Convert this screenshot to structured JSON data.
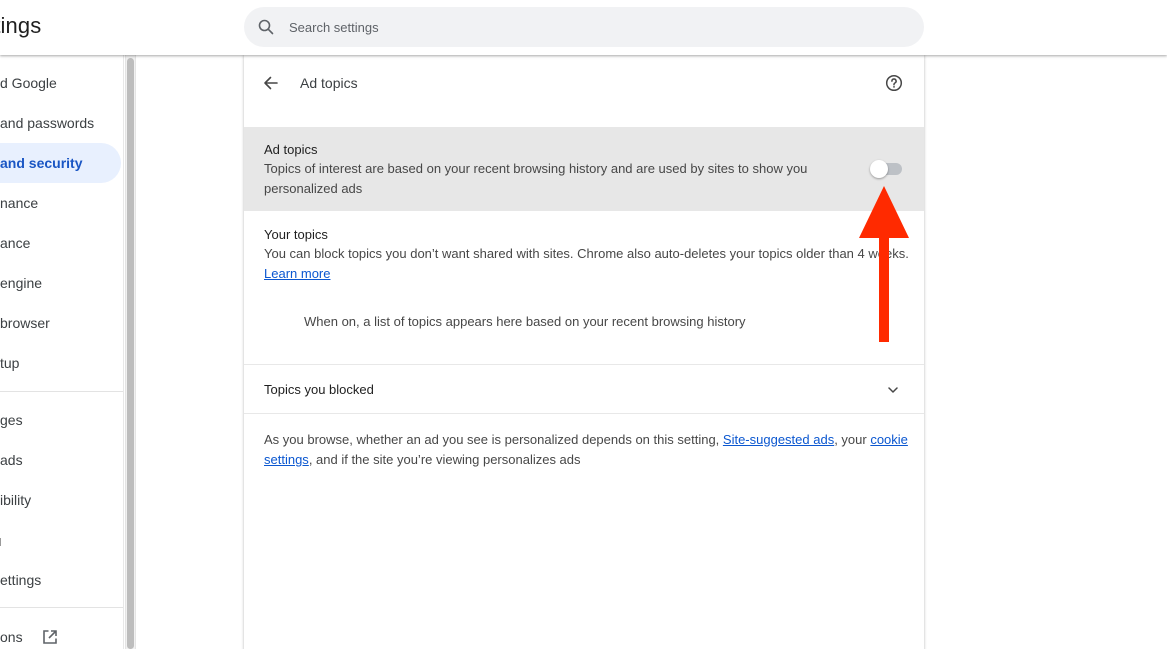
{
  "header": {
    "app_title": "Settings",
    "search": {
      "placeholder": "Search settings",
      "value": ""
    }
  },
  "sidebar": {
    "items": [
      {
        "label": "You and Google",
        "visible": "d Google",
        "active": false
      },
      {
        "label": "Autofill and passwords",
        "visible": " and passwords",
        "active": false
      },
      {
        "label": "Privacy and security",
        "visible": " and security",
        "active": true
      },
      {
        "label": "Performance",
        "visible": "nance",
        "active": false
      },
      {
        "label": "Appearance",
        "visible": "ance",
        "active": false
      },
      {
        "label": "Search engine",
        "visible": " engine",
        "active": false
      },
      {
        "label": "Default browser",
        "visible": " browser",
        "active": false
      },
      {
        "label": "On startup",
        "visible": "tup",
        "active": false
      },
      {
        "label": "Languages",
        "visible": "ges",
        "active": false
      },
      {
        "label": "Downloads",
        "visible": "ads",
        "active": false
      },
      {
        "label": "Accessibility",
        "visible": "ibility",
        "active": false
      },
      {
        "label": "System",
        "visible": "",
        "active": false
      },
      {
        "label": "Reset settings",
        "visible": "ettings",
        "active": false
      },
      {
        "label": "Extensions",
        "visible": "ons",
        "active": false,
        "icon": "open-in-new-icon"
      }
    ]
  },
  "page": {
    "title": "Ad topics",
    "back_icon": "arrow-left-icon",
    "help_icon": "help-circle-icon",
    "ad_topics_toggle": {
      "title": "Ad topics",
      "description": "Topics of interest are based on your recent browsing history and are used by sites to show you personalized ads",
      "enabled": false
    },
    "your_topics": {
      "title": "Your topics",
      "description": "You can block topics you don’t want shared with sites. Chrome also auto-deletes your topics older than 4 weeks.",
      "link": "Learn more",
      "empty_note": "When on, a list of topics appears here based on your recent browsing history"
    },
    "topics_blocked": {
      "label": "Topics you blocked",
      "icon": "chevron-down-icon"
    },
    "footer": {
      "text_before": "As you browse, whether an ad you see is personalized depends on this setting, ",
      "link1": "Site-suggested ads",
      "text_middle": ", your ",
      "link2": "cookie settings",
      "text_after": ", and if the site you’re viewing personalizes ads"
    }
  },
  "annotation": {
    "type": "arrow",
    "color": "#ff2a00",
    "points_to": "ad-topics-toggle"
  },
  "colors": {
    "accent": "#0b57d0",
    "active_nav_bg": "#e8f0fe",
    "active_nav_text": "#1a56c4",
    "highlight_row": "#e7e7e7"
  }
}
